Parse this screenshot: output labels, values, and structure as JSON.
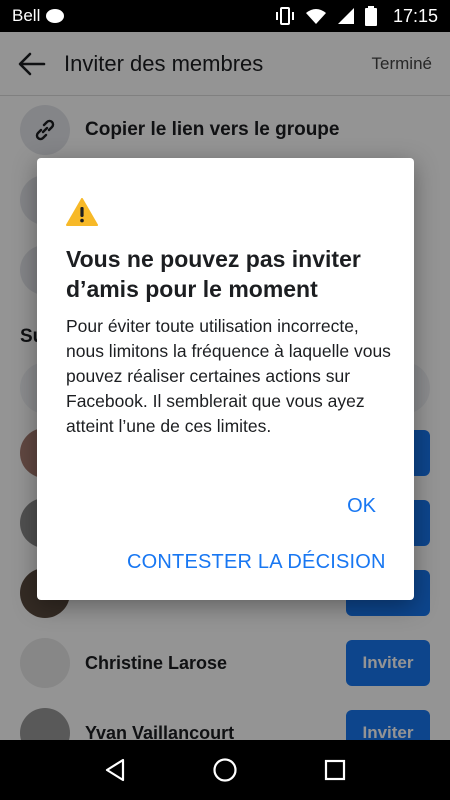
{
  "status_bar": {
    "carrier": "Bell",
    "time": "17:15",
    "icons": [
      "message-icon",
      "vibrate-icon",
      "wifi-icon",
      "signal-icon",
      "battery-icon"
    ]
  },
  "header": {
    "back_icon": "arrow-left-icon",
    "title": "Inviter des membres",
    "done_label": "Terminé"
  },
  "options": [
    {
      "icon": "link-icon",
      "label": "Copier le lien vers le groupe"
    }
  ],
  "suggestions": {
    "section_label": "Su",
    "people": [
      {
        "name": "",
        "action": "Inviter"
      },
      {
        "name": "",
        "action": "Inviter"
      },
      {
        "name": "",
        "action": "Inviter"
      },
      {
        "name": "Christine Larose",
        "action": "Inviter"
      },
      {
        "name": "Yvan Vaillancourt",
        "action": "Inviter"
      }
    ]
  },
  "dialog": {
    "icon": "warning-icon",
    "title": "Vous ne pouvez pas inviter d’amis pour le moment",
    "body": "Pour éviter toute utilisation incorrecte, nous limitons la fréquence à laquelle vous pouvez réaliser certaines actions sur Facebook. Il semblerait que vous ayez atteint l’une de ces limites.",
    "ok_label": "OK",
    "contest_label": "CONTESTER LA DÉCISION"
  },
  "nav_bar": {
    "icons": [
      "back-triangle-icon",
      "home-circle-icon",
      "recents-square-icon"
    ]
  },
  "colors": {
    "accent": "#1877f2",
    "warning": "#f7b928",
    "scrim": "rgba(0,0,0,0.42)"
  }
}
